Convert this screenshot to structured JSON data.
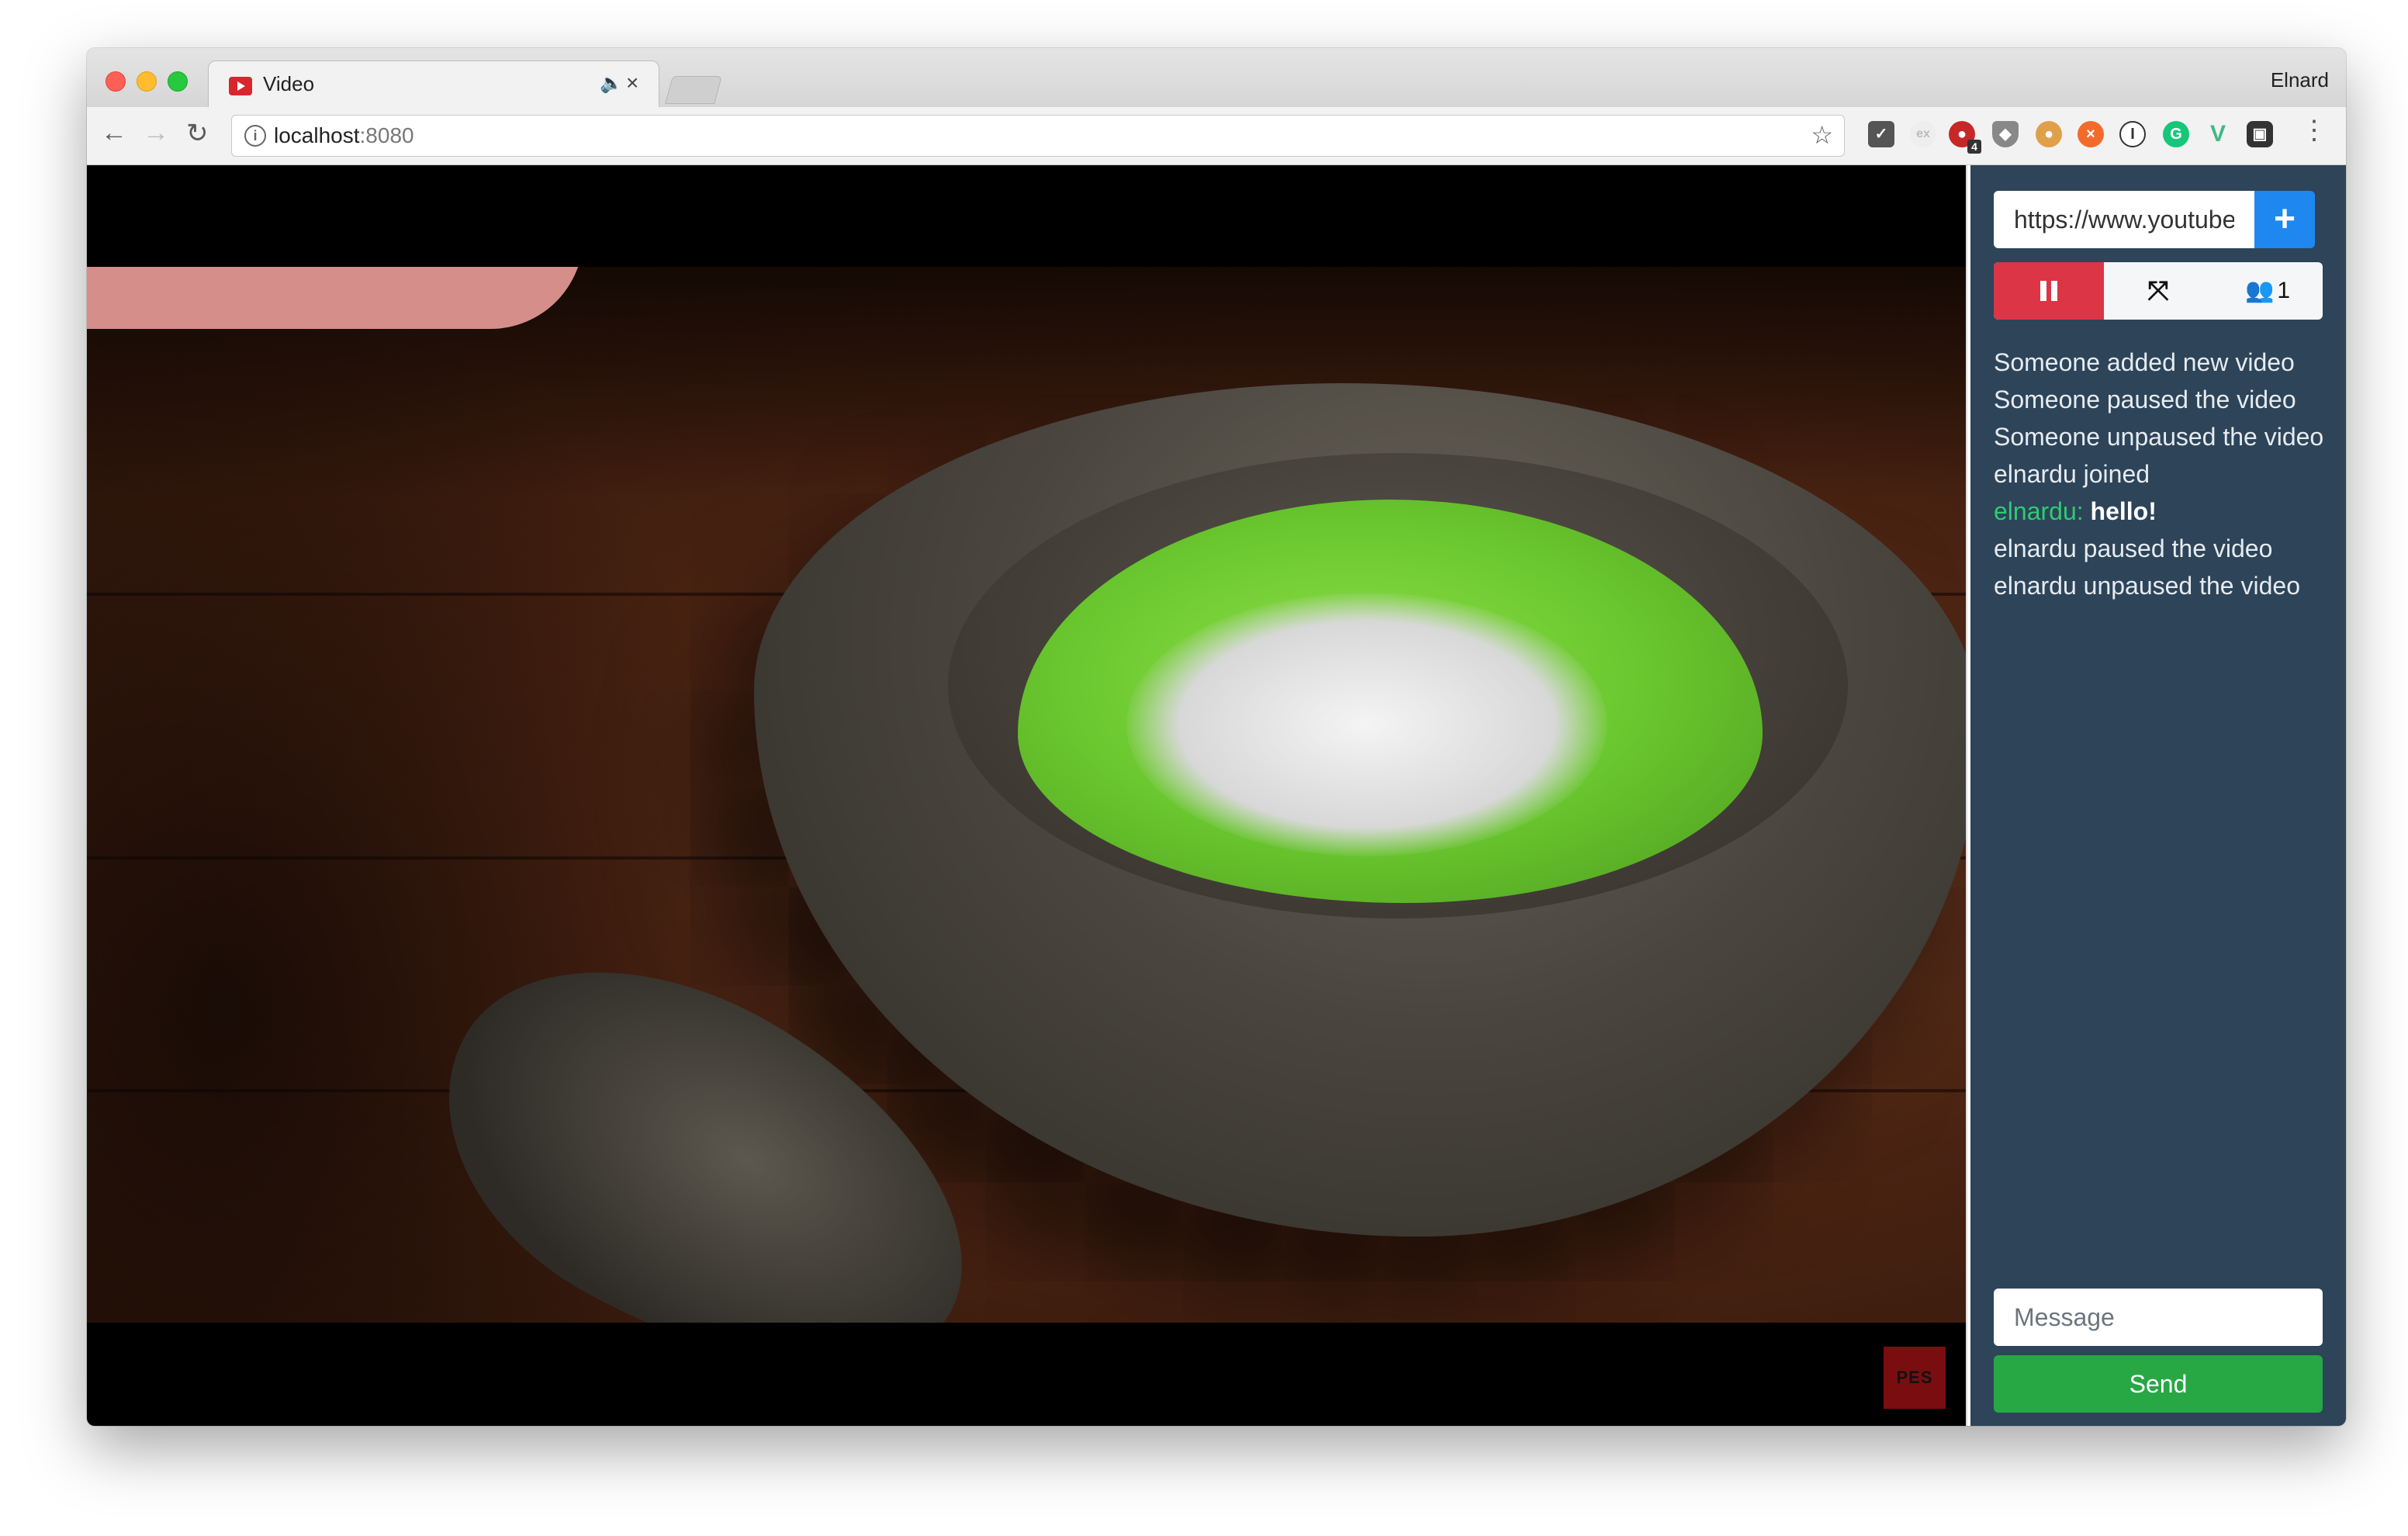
{
  "browser": {
    "tab_title": "Video",
    "profile_name": "Elnard",
    "url_host": "localhost",
    "url_port": ":8080"
  },
  "toolbar_icons": [
    "back-icon",
    "forward-icon",
    "reload-icon",
    "info-icon",
    "star-icon",
    "pocket-icon",
    "extension-icon",
    "menu-icon"
  ],
  "extension_badge": "4",
  "sidebar": {
    "video_url_value": "https://www.youtube",
    "add_label": "+",
    "users_count": "1",
    "messages": [
      {
        "text": "Someone added new video"
      },
      {
        "text": "Someone paused the video"
      },
      {
        "text": "Someone unpaused the video"
      },
      {
        "text": "elnardu joined"
      },
      {
        "user": "elnardu:",
        "text": "hello!"
      },
      {
        "text": "elnardu paused the video"
      },
      {
        "text": "elnardu unpaused the video"
      }
    ],
    "message_placeholder": "Message",
    "send_label": "Send"
  },
  "video": {
    "channel_logo_text": "PES"
  },
  "colors": {
    "sidebar_bg": "#2d4459",
    "pause_button": "#dc3545",
    "add_button": "#1e88f0",
    "send_button": "#28a745",
    "chat_username": "#2ecc71"
  }
}
